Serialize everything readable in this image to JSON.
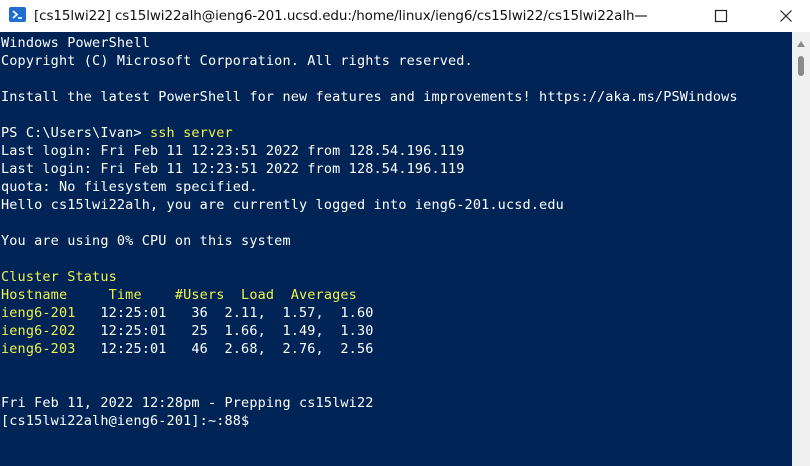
{
  "window": {
    "title": "[cs15lwi22]  cs15lwi22alh@ieng6-201.ucsd.edu:/home/linux/ieng6/cs15lwi22/cs15lwi22alh",
    "icon": "powershell-icon",
    "buttons": [
      "minimize-icon",
      "maximize-icon",
      "close-icon"
    ]
  },
  "colors": {
    "background": "#012456",
    "text": "#ffffff",
    "accent": "#f1f14b"
  },
  "terminal": {
    "header": {
      "line1": "Windows PowerShell",
      "line2": "Copyright (C) Microsoft Corporation. All rights reserved.",
      "line3": "Install the latest PowerShell for new features and improvements! https://aka.ms/PSWindows"
    },
    "prompt": {
      "path": "PS C:\\Users\\Ivan> ",
      "command": "ssh server"
    },
    "login": [
      "Last login: Fri Feb 11 12:23:51 2022 from 128.54.196.119",
      "Last login: Fri Feb 11 12:23:51 2022 from 128.54.196.119",
      "quota: No filesystem specified.",
      "Hello cs15lwi22alh, you are currently logged into ieng6-201.ucsd.edu"
    ],
    "cpu": "You are using 0% CPU on this system",
    "cluster": {
      "title": "Cluster Status",
      "header": "Hostname     Time    #Users  Load  Averages",
      "rows": [
        {
          "host": "ieng6-201",
          "stats": "   12:25:01   36  2.11,  1.57,  1.60"
        },
        {
          "host": "ieng6-202",
          "stats": "   12:25:01   25  1.66,  1.49,  1.30"
        },
        {
          "host": "ieng6-203",
          "stats": "   12:25:01   46  2.68,  2.76,  2.56"
        }
      ]
    },
    "footer": "Fri Feb 11, 2022 12:28pm - Prepping cs15lwi22",
    "shell_prompt": "[cs15lwi22alh@ieng6-201]:~:88$"
  }
}
